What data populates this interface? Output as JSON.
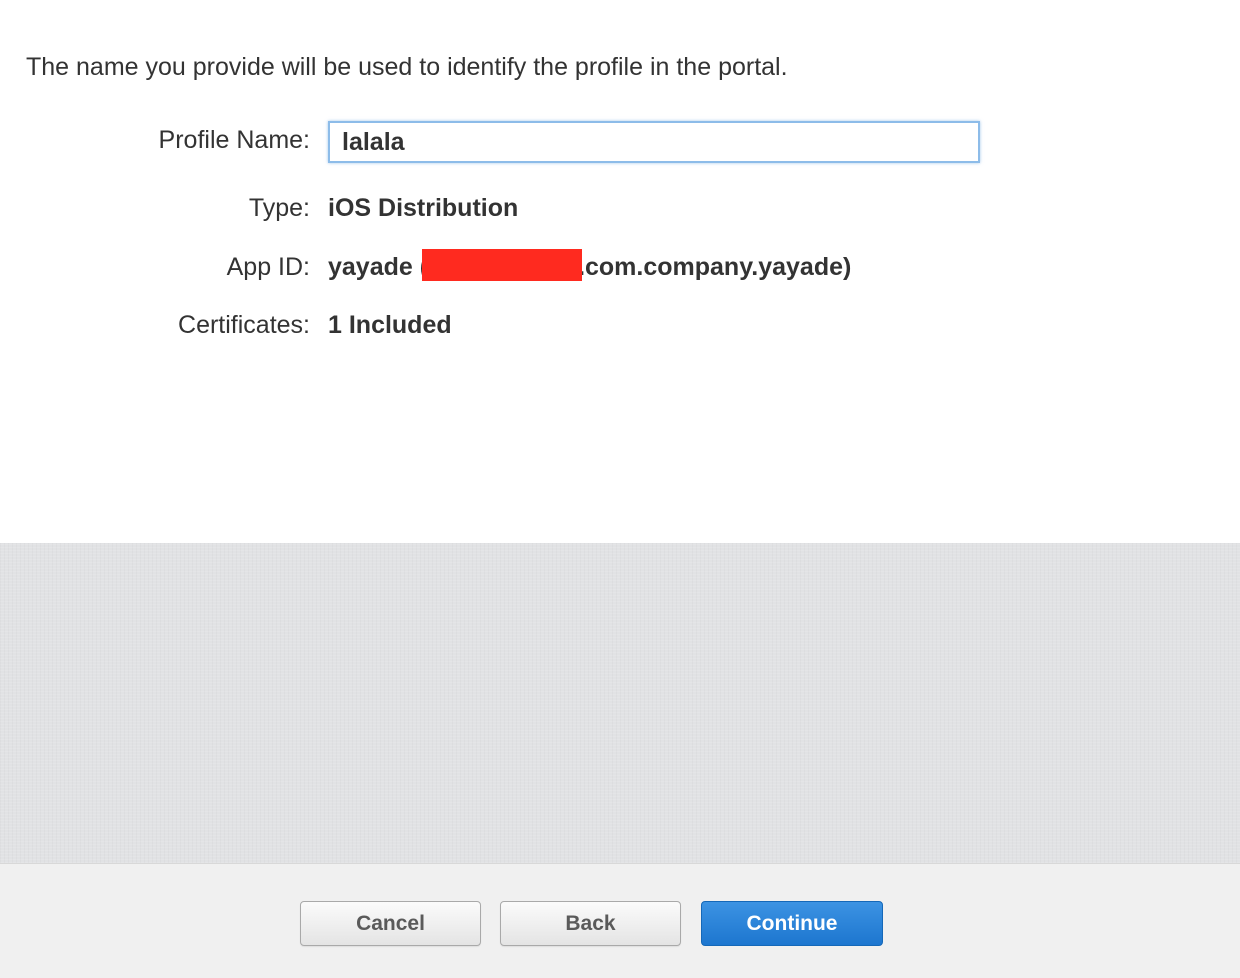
{
  "intro_text": "The name you provide will be used to identify the profile in the portal.",
  "fields": {
    "profile_name": {
      "label": "Profile Name:",
      "value": "lalala"
    },
    "type": {
      "label": "Type:",
      "value": "iOS Distribution"
    },
    "app_id": {
      "label": "App ID:",
      "value_prefix": "yayade (",
      "value_suffix": ".com.company.yayade)"
    },
    "certificates": {
      "label": "Certificates:",
      "value": "1 Included"
    }
  },
  "buttons": {
    "cancel": "Cancel",
    "back": "Back",
    "continue": "Continue"
  },
  "colors": {
    "redaction": "#ff2a1f",
    "primary_button": "#2a83d8"
  }
}
